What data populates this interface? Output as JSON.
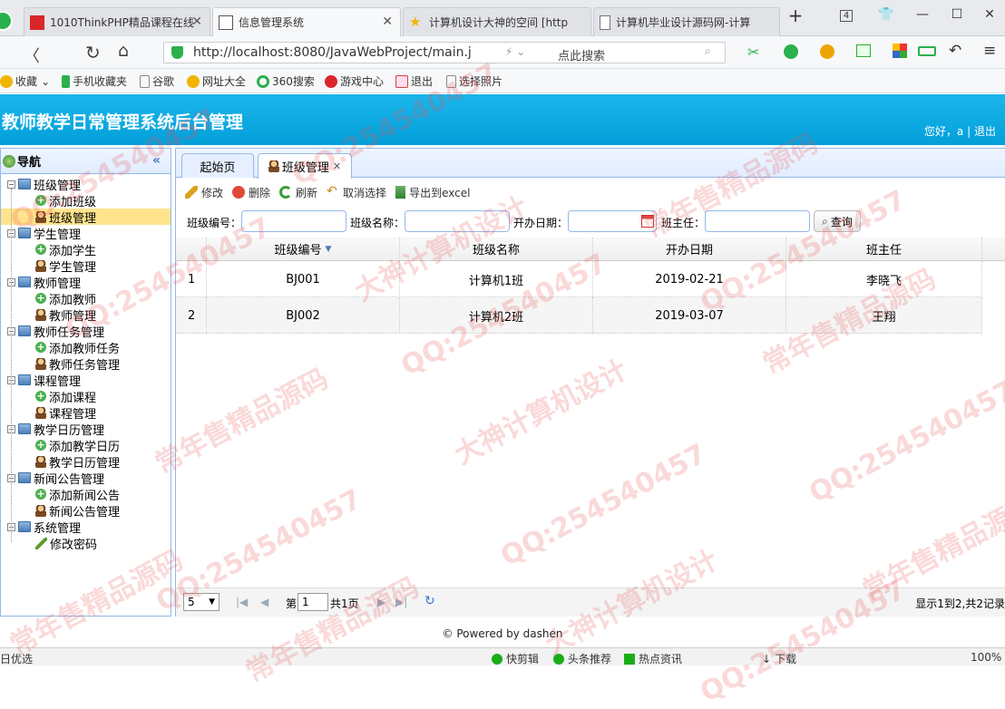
{
  "browser": {
    "tabs": [
      {
        "label": "1010ThinkPHP精品课程在线",
        "active": false
      },
      {
        "label": "信息管理系统",
        "active": true
      },
      {
        "label": "计算机设计大神的空间 [http",
        "active": false
      },
      {
        "label": "计算机毕业设计源码网-计算",
        "active": false
      }
    ],
    "tab_count": "4",
    "url": "http://localhost:8080/JavaWebProject/main.j",
    "search_placeholder": "点此搜索",
    "bookmarks": [
      "收藏",
      "手机收藏夹",
      "谷歌",
      "网址大全",
      "360搜索",
      "游戏中心",
      "退出",
      "选择照片"
    ]
  },
  "app": {
    "title": "教师教学日常管理系统后台管理",
    "greeting": "您好，a",
    "separator": "|",
    "logout": "退出"
  },
  "nav": {
    "title": "导航",
    "groups": [
      {
        "label": "班级管理",
        "items": [
          {
            "label": "添加班级",
            "icon": "add"
          },
          {
            "label": "班级管理",
            "icon": "user",
            "selected": true
          }
        ]
      },
      {
        "label": "学生管理",
        "items": [
          {
            "label": "添加学生",
            "icon": "add"
          },
          {
            "label": "学生管理",
            "icon": "user"
          }
        ]
      },
      {
        "label": "教师管理",
        "items": [
          {
            "label": "添加教师",
            "icon": "add"
          },
          {
            "label": "教师管理",
            "icon": "user"
          }
        ]
      },
      {
        "label": "教师任务管理",
        "items": [
          {
            "label": "添加教师任务",
            "icon": "add"
          },
          {
            "label": "教师任务管理",
            "icon": "user"
          }
        ]
      },
      {
        "label": "课程管理",
        "items": [
          {
            "label": "添加课程",
            "icon": "add"
          },
          {
            "label": "课程管理",
            "icon": "user"
          }
        ]
      },
      {
        "label": "教学日历管理",
        "items": [
          {
            "label": "添加教学日历",
            "icon": "add"
          },
          {
            "label": "教学日历管理",
            "icon": "user"
          }
        ]
      },
      {
        "label": "新闻公告管理",
        "items": [
          {
            "label": "添加新闻公告",
            "icon": "add"
          },
          {
            "label": "新闻公告管理",
            "icon": "user"
          }
        ]
      },
      {
        "label": "系统管理",
        "items": [
          {
            "label": "修改密码",
            "icon": "pen"
          }
        ]
      }
    ]
  },
  "main": {
    "tabs": [
      {
        "label": "起始页"
      },
      {
        "label": "班级管理",
        "closable": true
      }
    ],
    "toolbar": {
      "edit": "修改",
      "delete": "删除",
      "refresh": "刷新",
      "unselect": "取消选择",
      "export": "导出到excel"
    },
    "search": {
      "class_no_label": "班级编号：",
      "class_name_label": "班级名称：",
      "open_date_label": "开办日期：",
      "head_teacher_label": "班主任：",
      "query_label": "查询"
    },
    "grid": {
      "columns": [
        "班级编号",
        "班级名称",
        "开办日期",
        "班主任"
      ],
      "rows": [
        {
          "num": "1",
          "class_no": "BJ001",
          "class_name": "计算机1班",
          "open_date": "2019-02-21",
          "head_teacher": "李晓飞"
        },
        {
          "num": "2",
          "class_no": "BJ002",
          "class_name": "计算机2班",
          "open_date": "2019-03-07",
          "head_teacher": "王翔"
        }
      ]
    },
    "pager": {
      "page_size": "5",
      "page_prefix": "第",
      "page_value": "1",
      "page_suffix": "共1页",
      "summary": "显示1到2,共2记录"
    }
  },
  "footer": "© Powered by dashen",
  "statusbar": {
    "left": "日优选",
    "items": [
      "快剪辑",
      "头条推荐",
      "热点资讯",
      "下载"
    ],
    "zoom": "100%"
  },
  "watermark": {
    "qq": "QQ:254540457",
    "text1": "常年售精品源码",
    "text2": "大神计算机设计"
  }
}
